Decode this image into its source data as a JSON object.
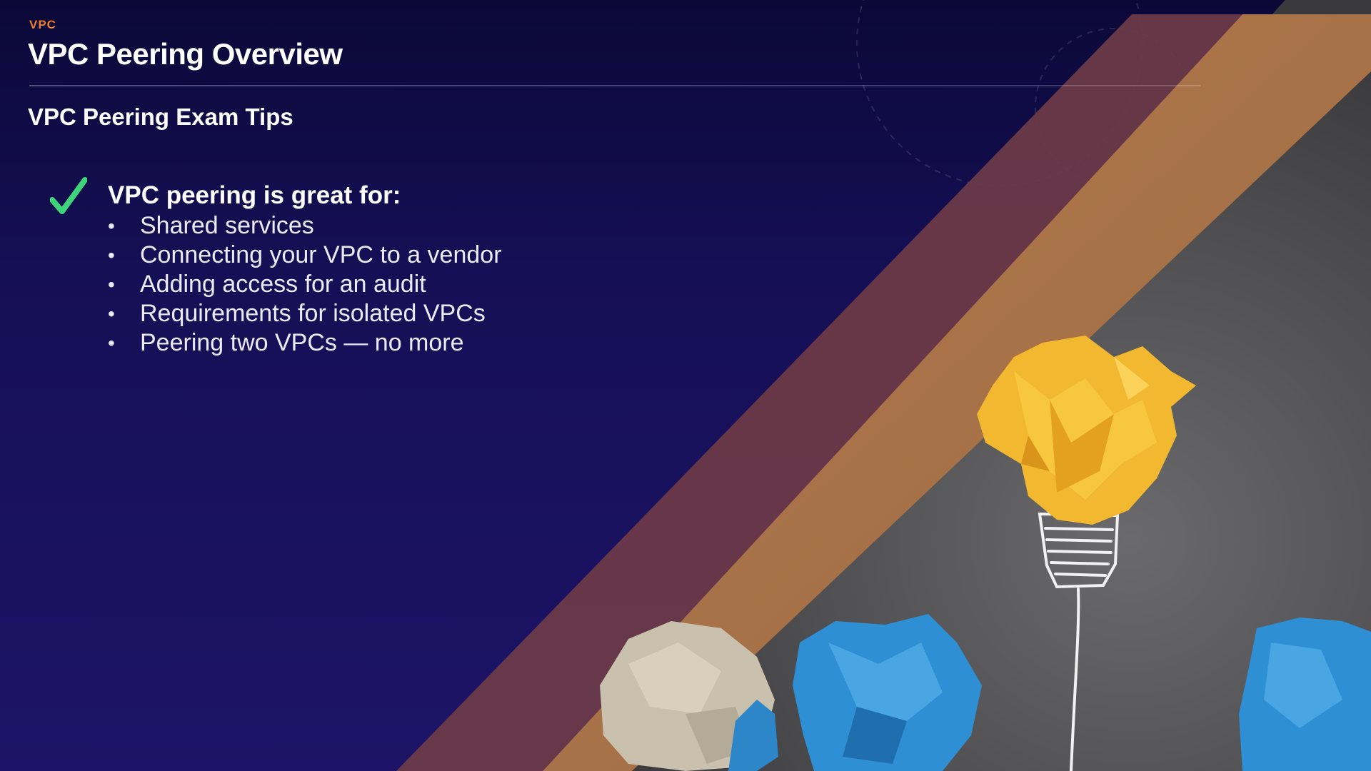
{
  "header": {
    "eyebrow": "VPC",
    "title": "VPC Peering Overview"
  },
  "section": {
    "subtitle": "VPC Peering Exam Tips"
  },
  "tips": {
    "icon": "check-icon",
    "heading": "VPC peering is great for:",
    "items": [
      "Shared services",
      "Connecting your VPC to a vendor",
      "Adding access for an audit",
      "Requirements for isolated VPCs",
      "Peering two VPCs — no more"
    ]
  },
  "colors": {
    "background": "#150f55",
    "eyebrow": "#f07a2f",
    "check": "#3dd47a",
    "stripe_red": "#6b3a48",
    "stripe_orange": "#b07849",
    "chalkboard": "#5a5a5c"
  }
}
